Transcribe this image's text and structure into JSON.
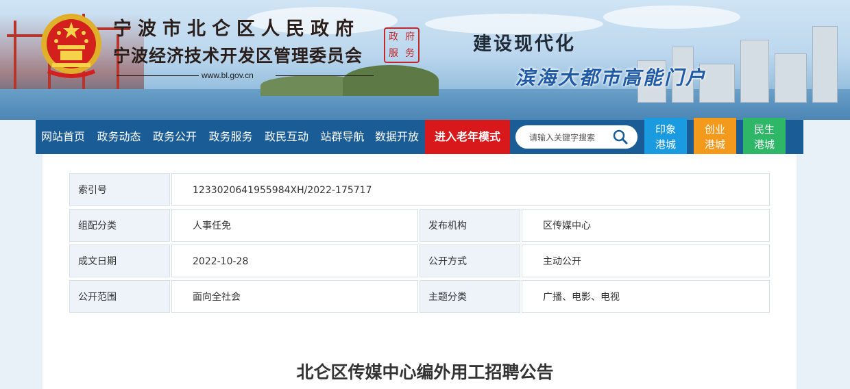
{
  "header": {
    "title_line1": "宁波市北仑区人民政府",
    "title_line2": "宁波经济技术开发区管理委员会",
    "url": "www.bl.gov.cn",
    "seal_chars": [
      "政",
      "府",
      "服",
      "务"
    ],
    "slogan_line1": "建设现代化",
    "slogan_line2": "滨海大都市高能门户"
  },
  "nav": {
    "items": [
      "网站首页",
      "政务动态",
      "政务公开",
      "政务服务",
      "政民互动",
      "站群导航",
      "数据开放"
    ],
    "elder_mode": "进入老年模式",
    "search_placeholder": "请输入关键字搜索",
    "city_buttons": [
      {
        "line1": "印象",
        "line2": "港城",
        "color": "#1a9be0"
      },
      {
        "line1": "创业",
        "line2": "港城",
        "color": "#f39a1c"
      },
      {
        "line1": "民生",
        "line2": "港城",
        "color": "#2db766"
      }
    ]
  },
  "meta": {
    "index_label": "索引号",
    "index_value": "1233020641955984XH/2022-175717",
    "category_label": "组配分类",
    "category_value": "人事任免",
    "publisher_label": "发布机构",
    "publisher_value": "区传媒中心",
    "date_label": "成文日期",
    "date_value": "2022-10-28",
    "open_mode_label": "公开方式",
    "open_mode_value": "主动公开",
    "scope_label": "公开范围",
    "scope_value": "面向全社会",
    "topic_label": "主题分类",
    "topic_value": "广播、电影、电视"
  },
  "article": {
    "title": "北仑区传媒中心编外用工招聘公告"
  },
  "colors": {
    "nav_bg": "#1a5c96",
    "elder_bg": "#d8181b",
    "meta_key_bg": "#edf3f9"
  }
}
